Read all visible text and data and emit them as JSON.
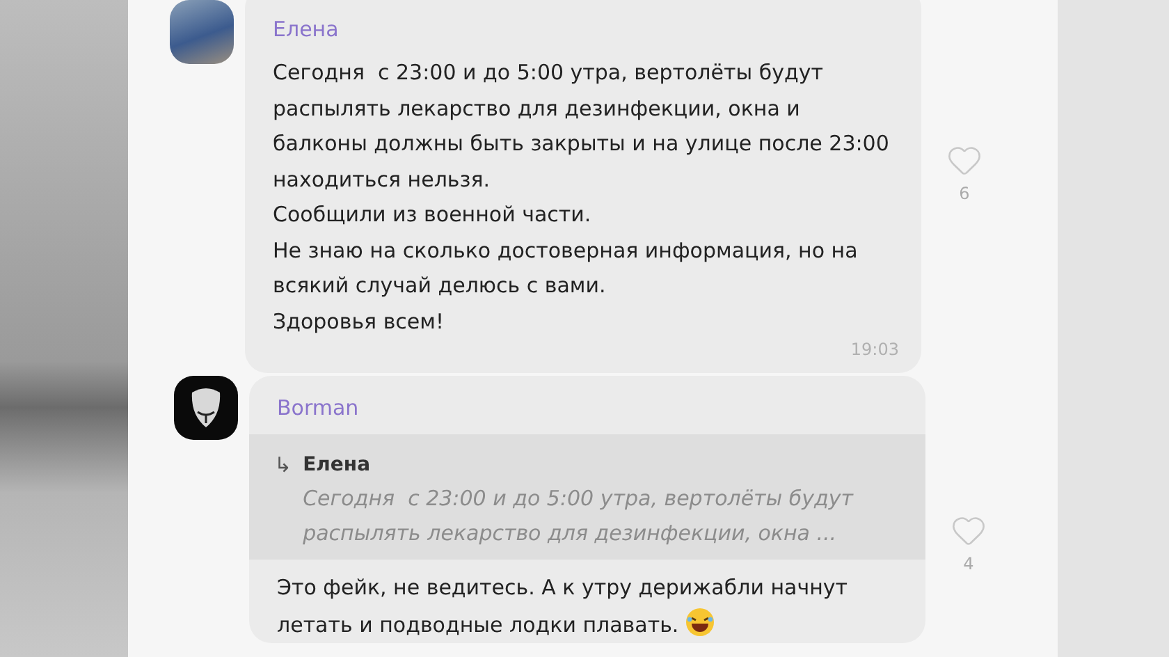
{
  "messages": [
    {
      "sender": "Елена",
      "photo_avatar": true,
      "lines": [
        "Сегодня  с 23:00 и до 5:00 утра, вертолёты будут",
        "распылять лекарство для дезинфекции, окна и",
        "балконы должны быть закрыты и на улице после 23:00",
        "находиться нельзя.",
        "Сообщили из военной части.",
        "Не знаю на сколько достоверная информация, но на",
        "всякий случай делюсь с вами.",
        "Здоровья всем!"
      ],
      "time": "19:03",
      "likes": "6",
      "liked": false
    },
    {
      "sender": "Borman",
      "photo_avatar": false,
      "reply": {
        "arrow": "↳",
        "sender": "Елена",
        "lines": [
          "Сегодня  с 23:00 и до 5:00 утра, вертолёты будут",
          "распылять лекарство для дезинфекции, окна ..."
        ]
      },
      "lines": [
        "Это фейк, не ведитесь. А к утру дерижабли начнут",
        "летать и подводные лодки плавать."
      ],
      "emoji": true,
      "likes": "4",
      "liked": false
    }
  ]
}
